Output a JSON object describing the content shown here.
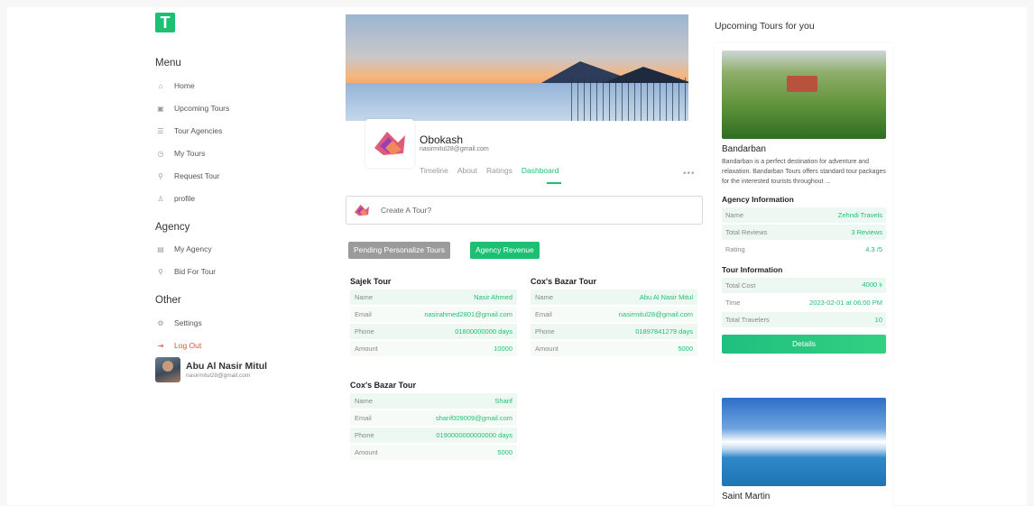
{
  "brand": {
    "logo_letter": "T",
    "accent": "#1dbf73"
  },
  "sidebar": {
    "menu_title": "Menu",
    "menu": [
      {
        "label": "Home",
        "icon": "home-icon"
      },
      {
        "label": "Upcoming Tours",
        "icon": "calendar-icon"
      },
      {
        "label": "Tour Agencies",
        "icon": "list-icon"
      },
      {
        "label": "My Tours",
        "icon": "clock-icon"
      },
      {
        "label": "Request Tour",
        "icon": "hiker-icon"
      },
      {
        "label": "profile",
        "icon": "user-icon"
      }
    ],
    "agency_title": "Agency",
    "agency": [
      {
        "label": "My Agency",
        "icon": "building-icon"
      },
      {
        "label": "Bid For Tour",
        "icon": "hiker-icon"
      }
    ],
    "other_title": "Other",
    "other": [
      {
        "label": "Settings",
        "icon": "gear-icon"
      },
      {
        "label": "Log Out",
        "icon": "logout-icon"
      }
    ],
    "user": {
      "name": "Abu Al Nasir Mitul",
      "email": "nasirmitul28@gmail.com"
    }
  },
  "profile": {
    "name": "Obokash",
    "email": "nasirmitul28@gmail.com",
    "tabs": [
      "Timeline",
      "About",
      "Ratings",
      "Dashboard"
    ],
    "active_tab": "Dashboard",
    "more": "•••"
  },
  "create_tour": {
    "placeholder": "Create A Tour?"
  },
  "dashboard_buttons": {
    "pending": "Pending Personalize Tours",
    "revenue": "Agency Revenue"
  },
  "tours": [
    {
      "title": "Sajek Tour",
      "rows": [
        {
          "k": "Name",
          "v": "Nasir Ahmed"
        },
        {
          "k": "Email",
          "v": "nasirahmed2801@gmail.com"
        },
        {
          "k": "Phone",
          "v": "01800000000 days"
        },
        {
          "k": "Amount",
          "v": "10000"
        }
      ]
    },
    {
      "title": "Cox's Bazar Tour",
      "rows": [
        {
          "k": "Name",
          "v": "Abu Al Nasir Mitul"
        },
        {
          "k": "Email",
          "v": "nasirmitul28@gmail.com"
        },
        {
          "k": "Phone",
          "v": "01897841279 days"
        },
        {
          "k": "Amount",
          "v": "5000"
        }
      ]
    },
    {
      "title": "Cox's Bazar Tour",
      "rows": [
        {
          "k": "Name",
          "v": "Sharif"
        },
        {
          "k": "Email",
          "v": "sharif009009@gmail.com"
        },
        {
          "k": "Phone",
          "v": "0190000000000000 days"
        },
        {
          "k": "Amount",
          "v": "5000"
        }
      ]
    }
  ],
  "upcoming": {
    "title": "Upcoming Tours for you",
    "items": [
      {
        "name": "Bandarban",
        "description": "Bandarban is a perfect destination for adventure and relaxation. Bandarban Tours offers standard tour packages for the interested tourists throughout ...",
        "agency_title": "Agency Information",
        "agency_rows": [
          {
            "k": "Name",
            "v": "Zehndi Travels"
          },
          {
            "k": "Total Reviews",
            "v": "3 Reviews"
          },
          {
            "k": "Rating",
            "v": "4.3 /5"
          }
        ],
        "tour_title": "Tour Information",
        "tour_rows": [
          {
            "k": "Total Cost",
            "v": "4000 ৳"
          },
          {
            "k": "Time",
            "v": "2023-02-01 at 06:00 PM"
          },
          {
            "k": "Total Travelers",
            "v": "10"
          }
        ],
        "button": "Details"
      },
      {
        "name": "Saint Martin"
      }
    ]
  }
}
